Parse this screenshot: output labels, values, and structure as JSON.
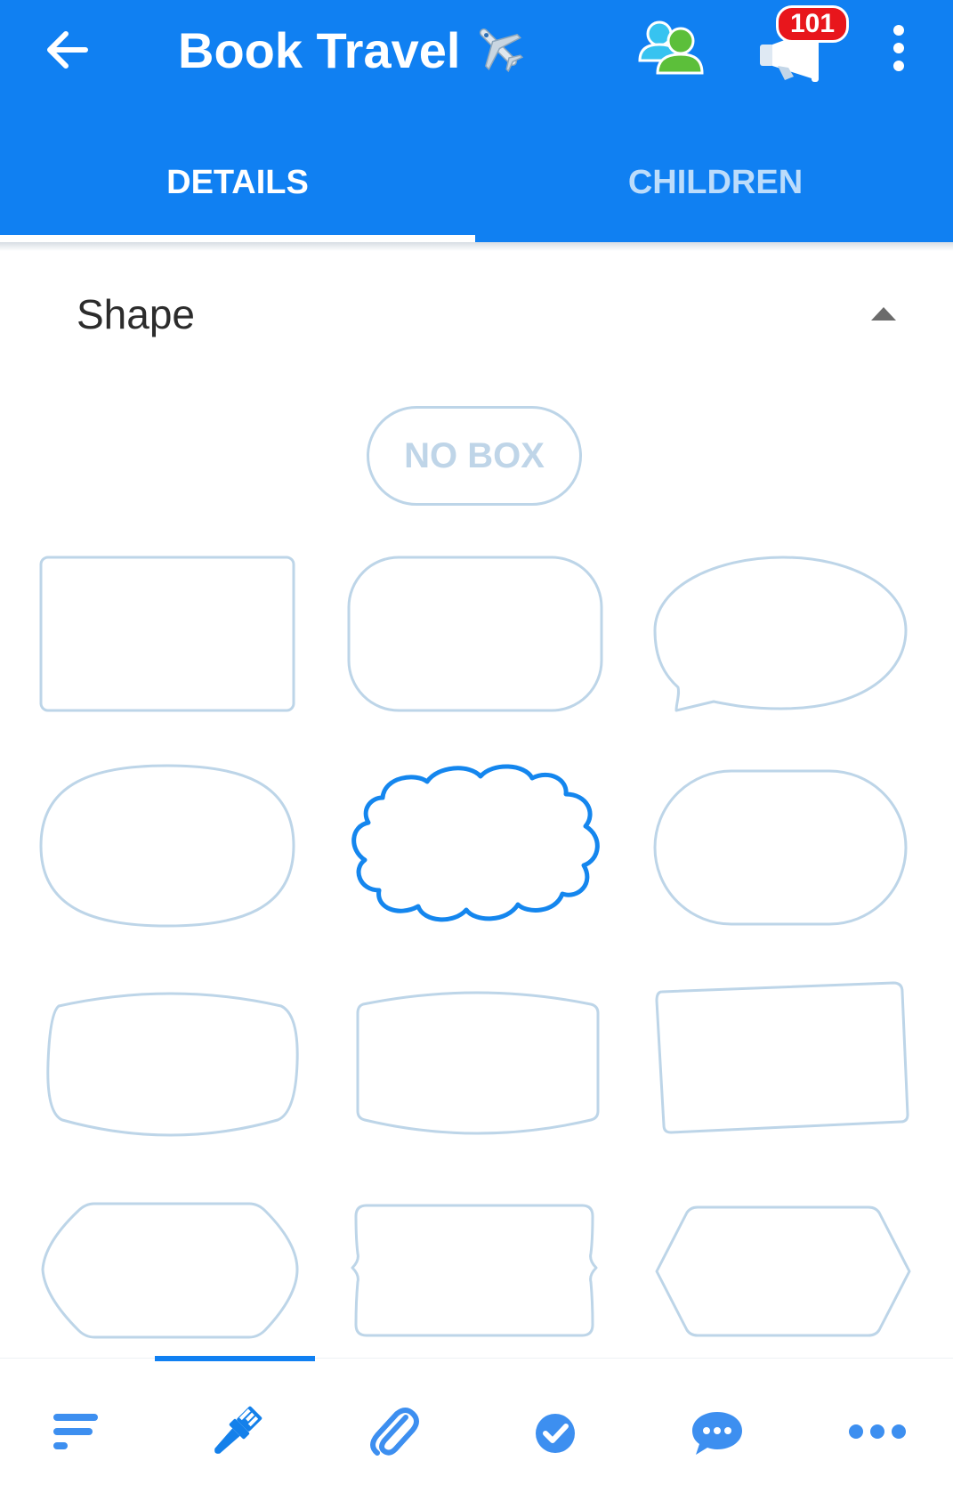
{
  "header": {
    "title": "Book Travel",
    "notification_count": "101",
    "icons": [
      "back-arrow-icon",
      "airplane-icon",
      "people-icon",
      "megaphone-icon",
      "more-vert-icon"
    ]
  },
  "tabs": [
    {
      "label": "DETAILS",
      "selected": true
    },
    {
      "label": "CHILDREN",
      "selected": false
    }
  ],
  "section": {
    "title": "Shape",
    "expanded": true
  },
  "shapes": {
    "no_box_label": "NO BOX",
    "items": [
      "rectangle",
      "rounded-rectangle",
      "speech-bubble",
      "ellipse",
      "cloud",
      "pill",
      "barrel",
      "cushion",
      "tilted-rectangle",
      "octagon-rounded",
      "ticket",
      "hexagon"
    ],
    "selected": "cloud"
  },
  "bottom_nav": {
    "items": [
      "notes-icon",
      "paintbrush-icon",
      "attachment-icon",
      "check-circle-icon",
      "chat-icon",
      "more-horiz-icon"
    ],
    "selected": "paintbrush-icon"
  },
  "colors": {
    "primary": "#1080f2",
    "shape_outline": "#bdd5e8",
    "badge": "#e8161c",
    "tab_inactive": "#bcdcfb"
  }
}
